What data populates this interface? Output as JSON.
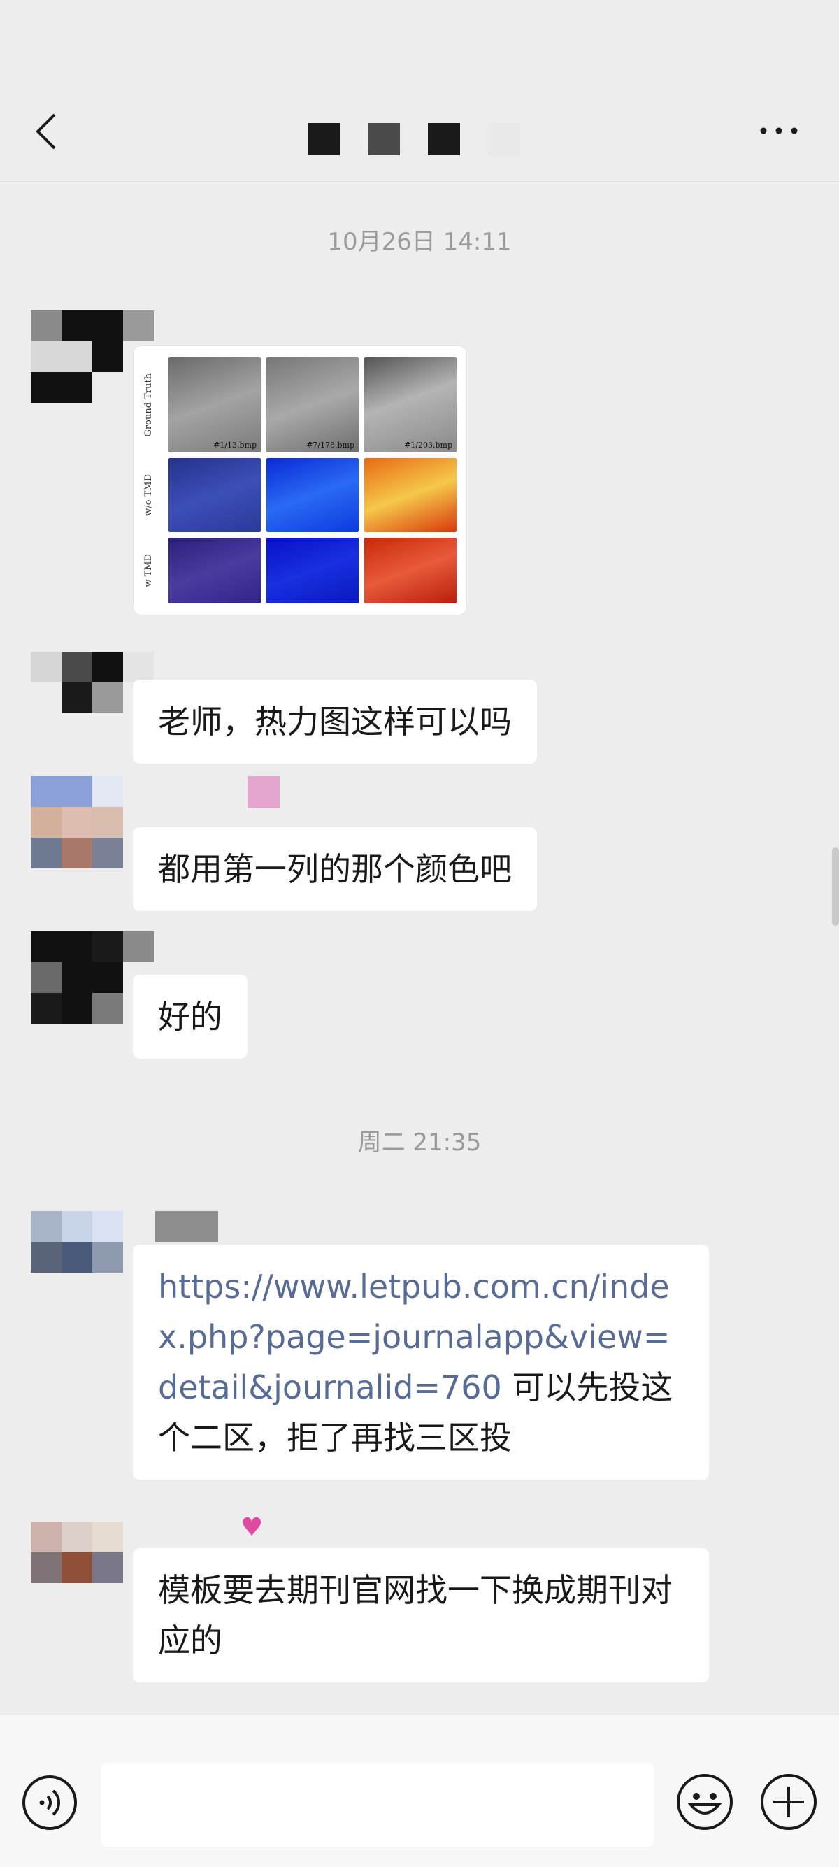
{
  "header": {
    "title_blocks": [
      "#1a1a1a",
      "#4a4a4a",
      "#1a1a1a",
      "#e9e9e9"
    ],
    "back_icon": "chevron-left-icon",
    "more_icon": "more-dots-icon"
  },
  "messages": {
    "time_1": "10月26日 14:11",
    "image_row_labels": [
      "Ground Truth",
      "w/o TMD",
      "w TMD"
    ],
    "image_captions": [
      "#1/13.bmp",
      "#7/178.bmp",
      "#1/203.bmp"
    ],
    "msg_1": "老师，热力图这样可以吗",
    "msg_2": "都用第一列的那个颜色吧",
    "msg_3": "好的",
    "time_2": "周二 21:35",
    "msg_4_link": "https://www.letpub.com.cn/index.php?page=journalapp&view=detail&journalid=760",
    "msg_4_text": "可以先投这个二区，拒了再找三区投",
    "msg_5": "模板要去期刊官网找一下换成期刊对应的"
  },
  "input_bar": {
    "voice_icon": "voice-icon",
    "emoji_icon": "emoji-icon",
    "plus_icon": "plus-icon",
    "placeholder": ""
  }
}
